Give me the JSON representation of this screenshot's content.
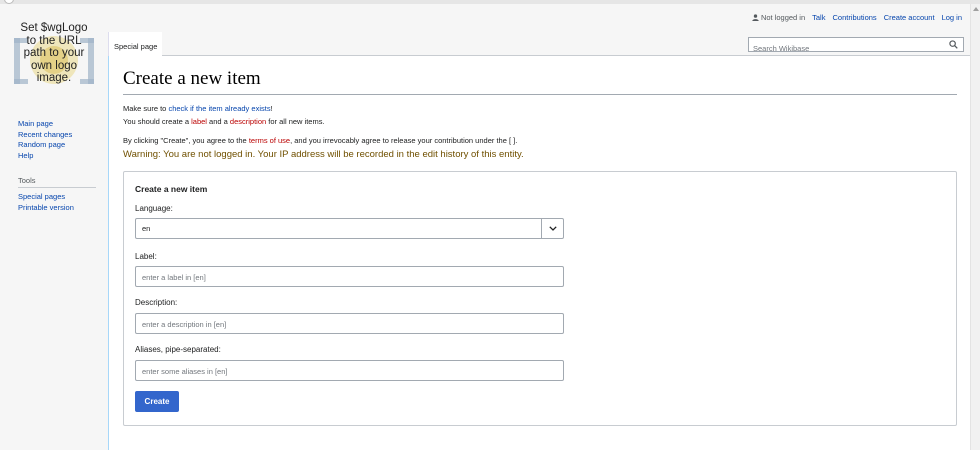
{
  "logo": {
    "lines": [
      "Set $wgLogo",
      "to the URL",
      "path to your",
      "own logo",
      "image."
    ]
  },
  "personal": {
    "status": "Not logged in",
    "links": [
      "Talk",
      "Contributions",
      "Create account",
      "Log in"
    ]
  },
  "tabs": {
    "special": "Special page"
  },
  "search": {
    "placeholder": "Search Wikibase"
  },
  "sidebar": {
    "navigation": [
      "Main page",
      "Recent changes",
      "Random page",
      "Help"
    ],
    "tools_heading": "Tools",
    "tools": [
      "Special pages",
      "Printable version"
    ]
  },
  "page": {
    "title": "Create a new item",
    "p1_before": "Make sure to ",
    "p1_link": "check if the item already exists",
    "p1_after": "!",
    "p2_before": "You should create a ",
    "p2_label": "label",
    "p2_mid": " and a ",
    "p2_desc": "description",
    "p2_after": " for all new items.",
    "p3_before": "By clicking \"Create\", you agree to the ",
    "p3_link": "terms of use",
    "p3_after": ", and you irrevocably agree to release your contribution under the [ ].",
    "warning": "Warning: You are not logged in. Your IP address will be recorded in the edit history of this entity."
  },
  "form": {
    "title": "Create a new item",
    "language_label": "Language:",
    "language_value": "en",
    "label_label": "Label:",
    "label_placeholder": "enter a label in [en]",
    "description_label": "Description:",
    "description_placeholder": "enter a description in [en]",
    "aliases_label": "Aliases, pipe-separated:",
    "aliases_placeholder": "enter some aliases in [en]",
    "create_button": "Create"
  },
  "colors": {
    "link": "#0645ad",
    "redlink": "#ba0000",
    "warning": "#705000",
    "button": "#3366cc"
  }
}
